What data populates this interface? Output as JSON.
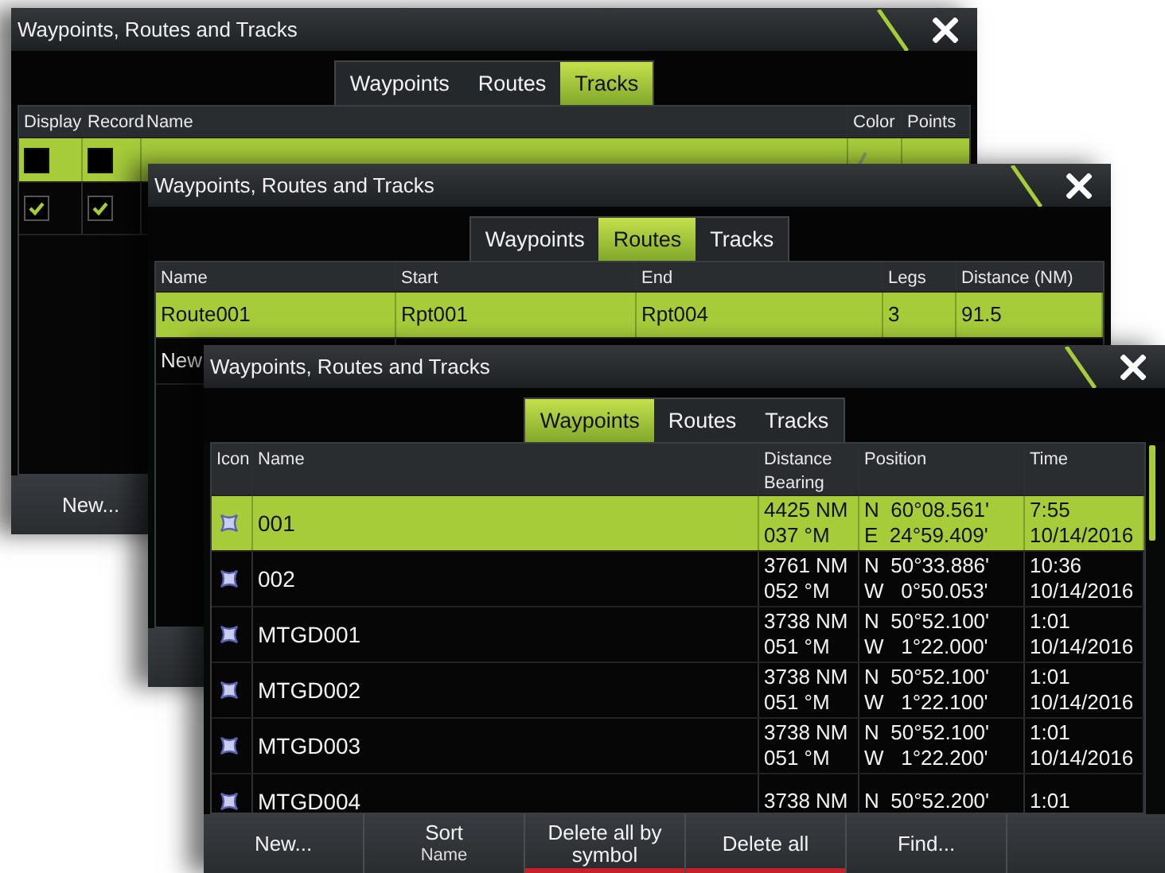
{
  "windows": [
    {
      "kind": "tracks",
      "title": "Waypoints, Routes and Tracks",
      "tabs": [
        {
          "label": "Waypoints",
          "selected": false
        },
        {
          "label": "Routes",
          "selected": false
        },
        {
          "label": "Tracks",
          "selected": true
        }
      ],
      "table": {
        "columns": [
          "Display",
          "Record",
          "Name",
          "Color",
          "Points"
        ],
        "rows": [
          {
            "selected": true,
            "cells": [
              {
                "kind": "check",
                "checked": false
              },
              {
                "kind": "check",
                "checked": false
              },
              {
                "kind": "blank"
              },
              {
                "kind": "pen"
              }
            ]
          },
          {
            "selected": false,
            "cells": [
              {
                "kind": "check",
                "checked": true
              },
              {
                "kind": "check",
                "checked": true
              }
            ]
          }
        ]
      },
      "footer": [
        {
          "label": "New..."
        }
      ]
    },
    {
      "kind": "routes",
      "title": "Waypoints, Routes and Tracks",
      "tabs": [
        {
          "label": "Waypoints",
          "selected": false
        },
        {
          "label": "Routes",
          "selected": true
        },
        {
          "label": "Tracks",
          "selected": false
        }
      ],
      "table": {
        "columns": [
          "Name",
          "Start",
          "End",
          "Legs",
          "Distance (NM)"
        ],
        "rows": [
          {
            "selected": true,
            "cells": [
              {
                "kind": "text",
                "text": "Route001"
              },
              {
                "kind": "text",
                "text": "Rpt001"
              },
              {
                "kind": "text",
                "text": "Rpt004"
              },
              {
                "kind": "text",
                "text": "3"
              },
              {
                "kind": "text",
                "text": "91.5"
              }
            ]
          },
          {
            "selected": false,
            "cells": [
              {
                "kind": "text",
                "text": "New"
              }
            ]
          }
        ]
      }
    },
    {
      "kind": "waypoints",
      "title": "Waypoints, Routes and Tracks",
      "tabs": [
        {
          "label": "Waypoints",
          "selected": true
        },
        {
          "label": "Routes",
          "selected": false
        },
        {
          "label": "Tracks",
          "selected": false
        }
      ],
      "table": {
        "columns": [
          "Icon",
          "Name",
          "Distance\nBearing",
          "Position",
          "Time"
        ],
        "rows": [
          {
            "selected": true,
            "cells": [
              {
                "kind": "waypoint"
              },
              {
                "kind": "text",
                "text": "001"
              },
              {
                "kind": "text",
                "text": "4425 NM\n037 °M"
              },
              {
                "kind": "text",
                "text": "N  60°08.561'\nE  24°59.409'"
              },
              {
                "kind": "text",
                "text": "7:55\n10/14/2016"
              }
            ]
          },
          {
            "selected": false,
            "cells": [
              {
                "kind": "waypoint"
              },
              {
                "kind": "text",
                "text": "002"
              },
              {
                "kind": "text",
                "text": "3761 NM\n052 °M"
              },
              {
                "kind": "text",
                "text": "N  50°33.886'\nW   0°50.053'"
              },
              {
                "kind": "text",
                "text": "10:36\n10/14/2016"
              }
            ]
          },
          {
            "selected": false,
            "cells": [
              {
                "kind": "waypoint"
              },
              {
                "kind": "text",
                "text": "MTGD001"
              },
              {
                "kind": "text",
                "text": "3738 NM\n051 °M"
              },
              {
                "kind": "text",
                "text": "N  50°52.100'\nW   1°22.000'"
              },
              {
                "kind": "text",
                "text": "1:01\n10/14/2016"
              }
            ]
          },
          {
            "selected": false,
            "cells": [
              {
                "kind": "waypoint"
              },
              {
                "kind": "text",
                "text": "MTGD002"
              },
              {
                "kind": "text",
                "text": "3738 NM\n051 °M"
              },
              {
                "kind": "text",
                "text": "N  50°52.100'\nW   1°22.100'"
              },
              {
                "kind": "text",
                "text": "1:01\n10/14/2016"
              }
            ]
          },
          {
            "selected": false,
            "cells": [
              {
                "kind": "waypoint"
              },
              {
                "kind": "text",
                "text": "MTGD003"
              },
              {
                "kind": "text",
                "text": "3738 NM\n051 °M"
              },
              {
                "kind": "text",
                "text": "N  50°52.100'\nW   1°22.200'"
              },
              {
                "kind": "text",
                "text": "1:01\n10/14/2016"
              }
            ]
          },
          {
            "selected": false,
            "cells": [
              {
                "kind": "waypoint"
              },
              {
                "kind": "text",
                "text": "MTGD004"
              },
              {
                "kind": "text",
                "text": "3738 NM"
              },
              {
                "kind": "text",
                "text": "N  50°52.200'"
              },
              {
                "kind": "text",
                "text": "1:01"
              }
            ]
          }
        ]
      },
      "footer": [
        {
          "label": "New..."
        },
        {
          "label": "Sort",
          "value": "Name"
        },
        {
          "label": "Delete all by symbol",
          "underlined": true
        },
        {
          "label": "Delete all",
          "underlined": true
        },
        {
          "label": "Find..."
        }
      ]
    }
  ]
}
